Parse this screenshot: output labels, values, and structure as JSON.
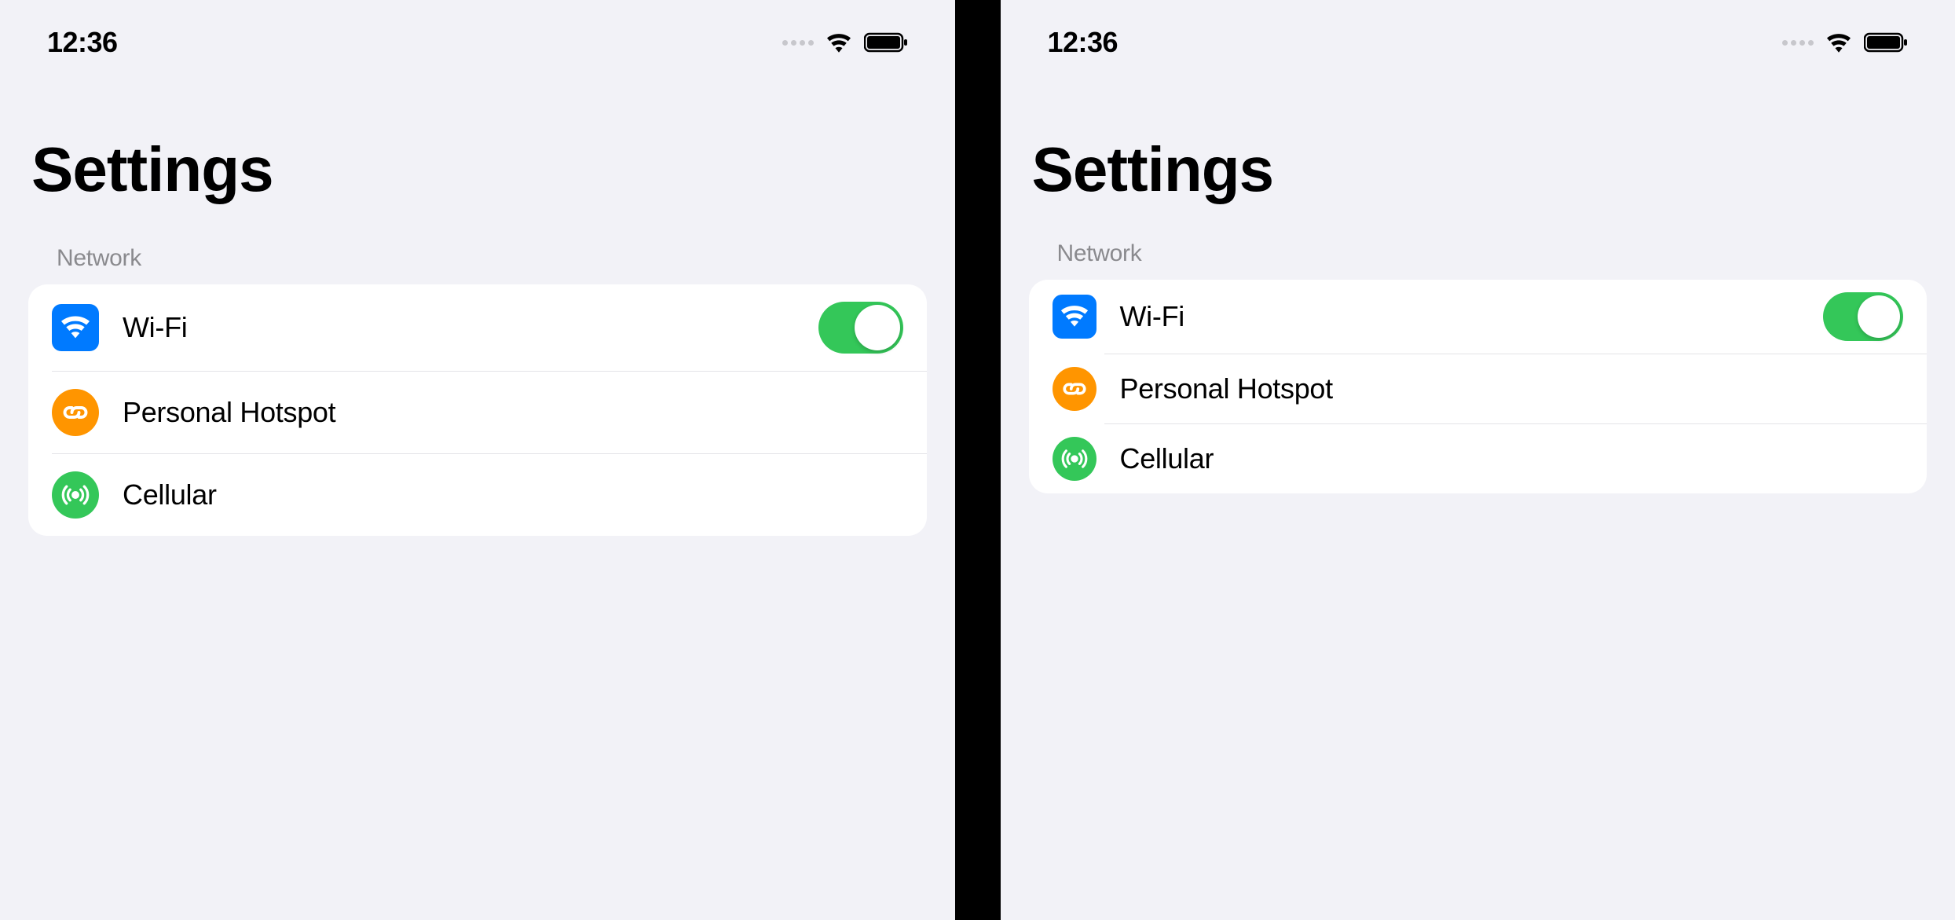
{
  "status": {
    "time": "12:36"
  },
  "page": {
    "title": "Settings"
  },
  "section": {
    "header": "Network",
    "rows": {
      "wifi": {
        "label": "Wi-Fi",
        "toggle_on": true
      },
      "hotspot": {
        "label": "Personal Hotspot"
      },
      "cellular": {
        "label": "Cellular"
      }
    }
  },
  "colors": {
    "blue": "#007aff",
    "orange": "#ff9500",
    "green": "#34c759",
    "background": "#f2f2f7",
    "separator": "#e3e3e7"
  },
  "icons": {
    "wifi": "wifi-icon",
    "hotspot": "link-icon",
    "cellular": "antenna-icon"
  }
}
